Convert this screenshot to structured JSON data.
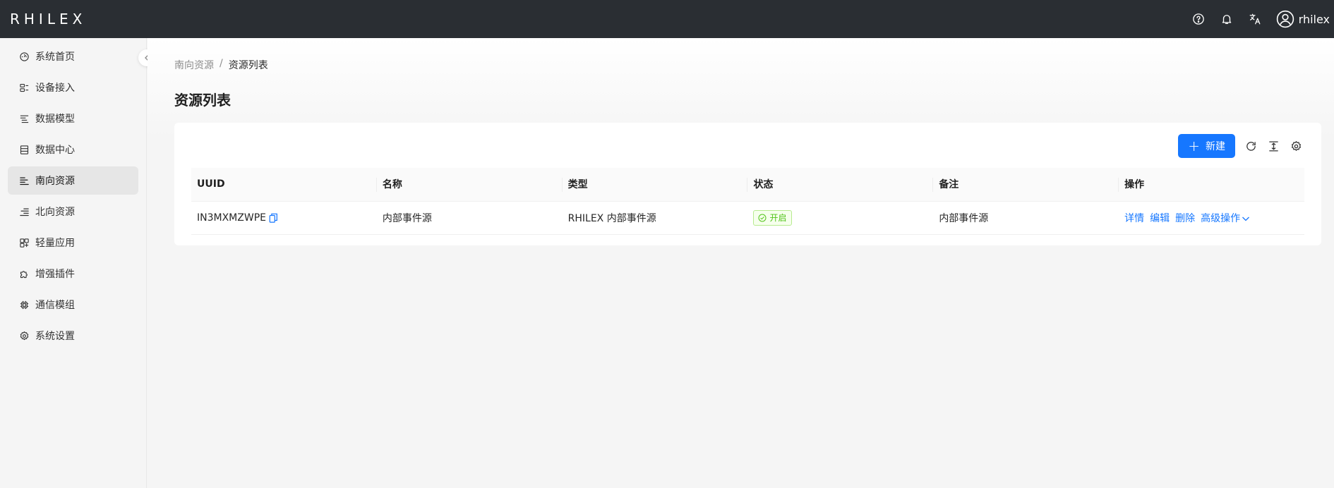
{
  "header": {
    "logo": "RHILEX",
    "username": "rhilex"
  },
  "sidebar": {
    "items": [
      {
        "label": "系统首页",
        "icon": "dashboard-icon"
      },
      {
        "label": "设备接入",
        "icon": "devices-icon"
      },
      {
        "label": "数据模型",
        "icon": "model-icon"
      },
      {
        "label": "数据中心",
        "icon": "database-icon"
      },
      {
        "label": "南向资源",
        "icon": "align-left-icon",
        "active": true
      },
      {
        "label": "北向资源",
        "icon": "align-right-icon"
      },
      {
        "label": "轻量应用",
        "icon": "apps-icon"
      },
      {
        "label": "增强插件",
        "icon": "plugin-icon"
      },
      {
        "label": "通信模组",
        "icon": "chip-icon"
      },
      {
        "label": "系统设置",
        "icon": "settings-icon"
      }
    ]
  },
  "breadcrumb": {
    "parent": "南向资源",
    "separator": "/",
    "current": "资源列表"
  },
  "page": {
    "title": "资源列表"
  },
  "toolbar": {
    "new_label": "新建"
  },
  "table": {
    "columns": [
      "UUID",
      "名称",
      "类型",
      "状态",
      "备注",
      "操作"
    ],
    "rows": [
      {
        "uuid": "IN3MXMZWPE",
        "name": "内部事件源",
        "type": "RHILEX 内部事件源",
        "status": "开启",
        "remark": "内部事件源",
        "actions": {
          "detail": "详情",
          "edit": "编辑",
          "delete": "删除",
          "advanced": "高级操作"
        }
      }
    ]
  },
  "colors": {
    "header_bg": "#2a2e33",
    "primary": "#1677ff",
    "success": "#52c41a"
  }
}
